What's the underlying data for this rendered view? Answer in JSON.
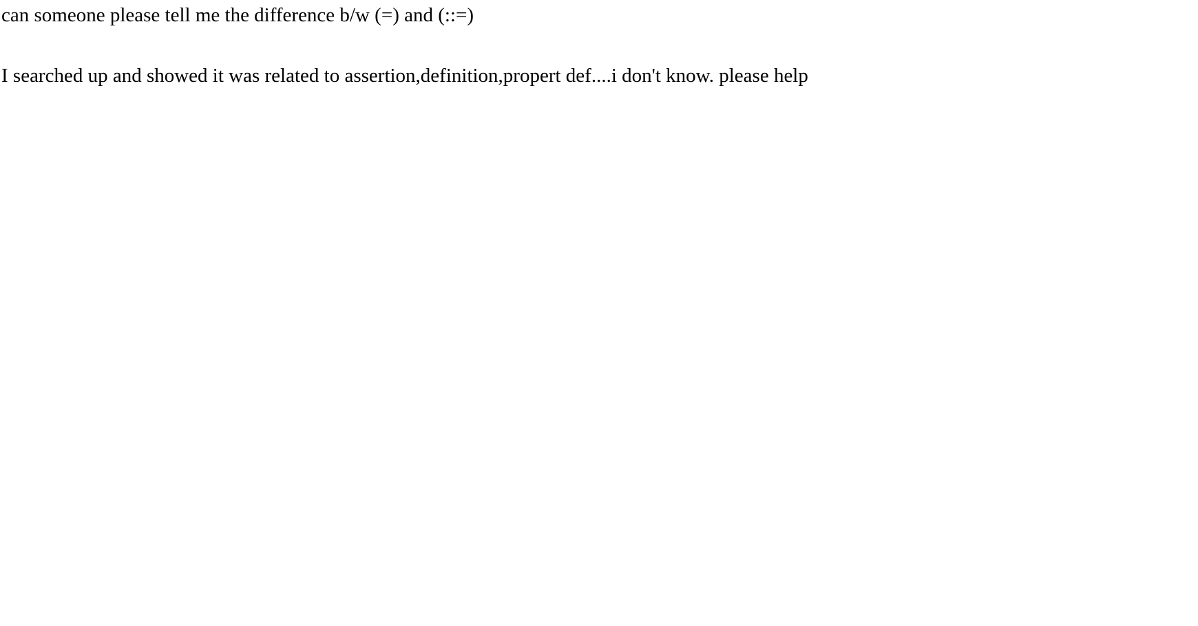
{
  "content": {
    "line1": "can someone please tell me the difference b/w (=) and (::=)",
    "line2": "I searched up and showed it was related to assertion,definition,propert def....i don't know. please help"
  }
}
